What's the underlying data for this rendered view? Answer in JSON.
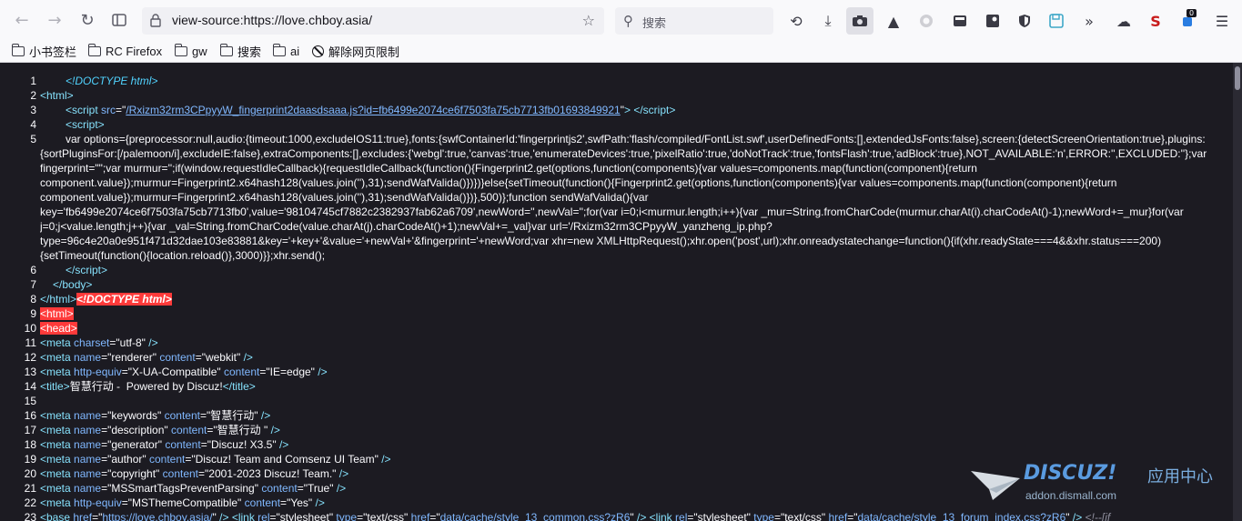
{
  "toolbar": {
    "url": "view-source:https://love.chboy.asia/",
    "search_placeholder": "搜索",
    "badge_count": "0"
  },
  "bookmarks": [
    {
      "label": "小书签栏",
      "icon": "folder-icon"
    },
    {
      "label": "RC Firefox",
      "icon": "folder-icon"
    },
    {
      "label": "gw",
      "icon": "folder-icon"
    },
    {
      "label": "搜索",
      "icon": "folder-icon"
    },
    {
      "label": "ai",
      "icon": "folder-icon"
    },
    {
      "label": "解除网页限制",
      "icon": "no-entry-icon"
    }
  ],
  "source": {
    "line_numbers": [
      "1",
      "2",
      "3",
      "4",
      "5",
      "6",
      "7",
      "8",
      "9",
      "10",
      "11",
      "12",
      "13",
      "14",
      "15",
      "16",
      "17",
      "18",
      "19",
      "20",
      "21",
      "22",
      "23"
    ],
    "l1": "<!DOCTYPE html>",
    "l3_src": "/Rxizm32rm3CPpyyW_fingerprint2daasdsaaa.js?id=fb6499e2074ce6f7503fa75cb7713fb01693849921",
    "l5_script": "var options={preprocessor:null,audio:{timeout:1000,excludeIOS11:true},fonts:{swfContainerId:'fingerprintjs2',swfPath:'flash/compiled/FontList.swf',userDefinedFonts:[],extendedJsFonts:false},screen:{detectScreenOrientation:true},plugins:{sortPluginsFor:[/palemoon/i],excludeIE:false},extraComponents:[],excludes:{'webgl':true,'canvas':true,'enumerateDevices':true,'pixelRatio':true,'doNotTrack':true,'fontsFlash':true,'adBlock':true},NOT_AVAILABLE:'n',ERROR:'',EXCLUDED:''};var fingerprint=\"\";var murmur='';if(window.requestIdleCallback){requestIdleCallback(function(){Fingerprint2.get(options,function(components){var values=components.map(function(component){return component.value});murmur=Fingerprint2.x64hash128(values.join(''),31);sendWafValida()})})}else{setTimeout(function(){Fingerprint2.get(options,function(components){var values=components.map(function(component){return component.value});murmur=Fingerprint2.x64hash128(values.join(''),31);sendWafValida()})},500)};function sendWafValida(){var key='fb6499e2074ce6f7503fa75cb7713fb0',value='98104745cf7882c2382937fab62a6709',newWord='',newVal='';for(var i=0;i<murmur.length;i++){var _mur=String.fromCharCode(murmur.charAt(i).charCodeAt()-1);newWord+=_mur}for(var j=0;j<value.length;j++){var _val=String.fromCharCode(value.charAt(j).charCodeAt()+1);newVal+=_val}var url='/Rxizm32rm3CPpyyW_yanzheng_ip.php?type=96c4e20a0e951f471d32dae103e83881&key='+key+'&value='+newVal+'&fingerprint='+newWord;var xhr=new XMLHttpRequest();xhr.open('post',url);xhr.onreadystatechange=function(){if(xhr.readyState===4&&xhr.status===200){setTimeout(function(){location.reload()},3000)}};xhr.send();",
    "l8_err": "<!DOCTYPE html>",
    "l9_err": "<html>",
    "l10_err": "<head>",
    "l11_charset": "\"utf-8\"",
    "l12_name": "\"renderer\"",
    "l12_content": "\"webkit\"",
    "l13_equiv": "\"X-UA-Compatible\"",
    "l13_content": "\"IE=edge\"",
    "l14_title": "智慧行动 -  Powered by Discuz!",
    "l16_name": "\"keywords\"",
    "l16_content": "\"智慧行动\"",
    "l17_name": "\"description\"",
    "l17_content": "\"智慧行动 \"",
    "l18_name": "\"generator\"",
    "l18_content": "\"Discuz! X3.5\"",
    "l19_name": "\"author\"",
    "l19_content": "\"Discuz! Team and Comsenz UI Team\"",
    "l20_name": "\"copyright\"",
    "l20_content": "\"2001-2023 Discuz! Team.\"",
    "l21_name": "\"MSSmartTagsPreventParsing\"",
    "l21_content": "\"True\"",
    "l22_equiv": "\"MSThemeCompatible\"",
    "l22_content": "\"Yes\"",
    "l23_base": "https://love.chboy.asia/",
    "l23_css1": "data/cache/style_13_common.css?zR6",
    "l23_css2": "data/cache/style_13_forum_index.css?zR6",
    "l23_tail": "<!--[if"
  },
  "watermark": {
    "brand": "DISCUZ!",
    "cn": "应用中心",
    "url": "addon.dismall.com"
  }
}
